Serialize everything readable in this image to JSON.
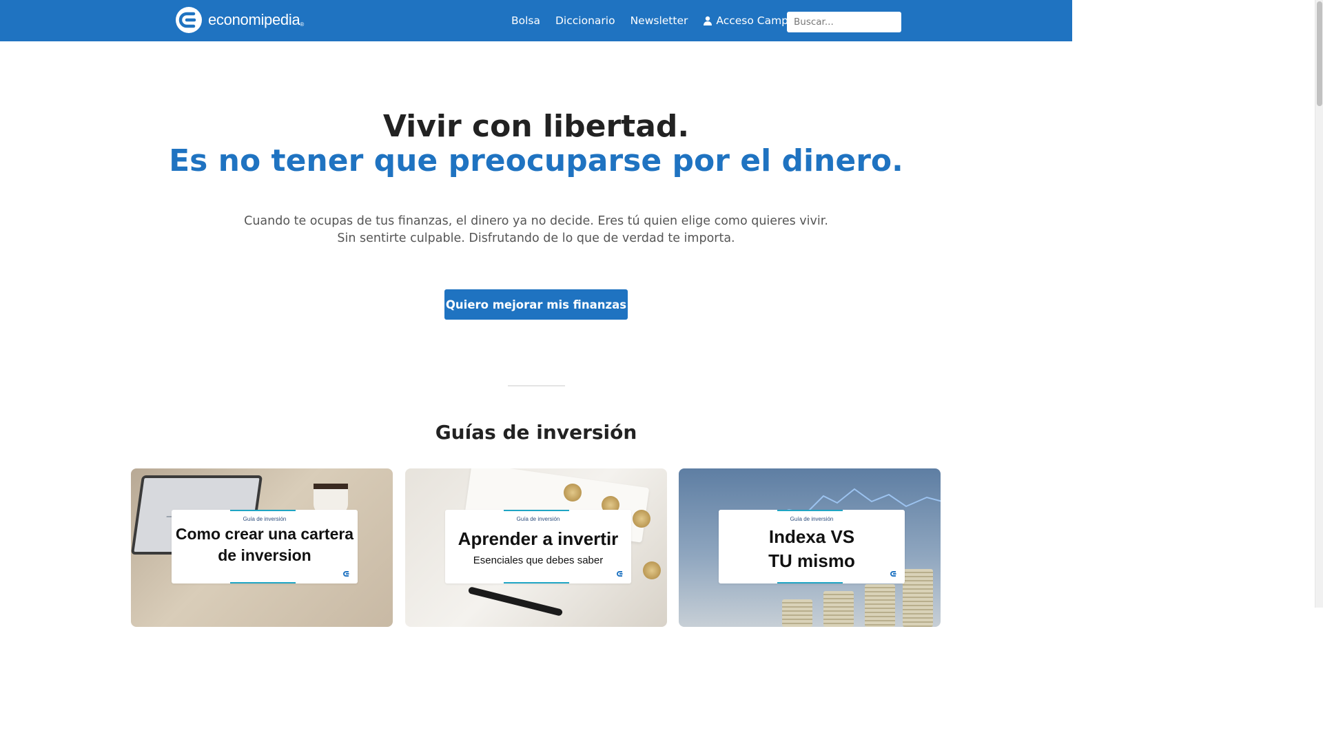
{
  "header": {
    "logo_text": "economipedia",
    "logo_mark": "®",
    "nav": [
      {
        "label": "Bolsa"
      },
      {
        "label": "Diccionario"
      },
      {
        "label": "Newsletter"
      },
      {
        "label": "Acceso Campus",
        "icon": "user-icon"
      }
    ],
    "search": {
      "placeholder": "Buscar...",
      "value": ""
    },
    "background": "#1f73c1"
  },
  "hero": {
    "title": "Vivir con libertad.",
    "subtitle": "Es no tener que preocuparse por el dinero.",
    "text_line1": "Cuando te ocupas de tus finanzas, el dinero ya no decide. Eres tú quien elige como quieres vivir.",
    "text_line2": "Sin sentirte culpable. Disfrutando de lo que de verdad te importa.",
    "cta_label": "Quiero mejorar mis finanzas",
    "accent": "#1f73c1"
  },
  "guides": {
    "title": "Guías de inversión",
    "cards": [
      {
        "tag": "Guía de inversión",
        "heading": "Como crear una cartera\nde inversion"
      },
      {
        "tag": "Guía de inversión",
        "heading": "Aprender a invertir",
        "subheading": "Esenciales que debes saber"
      },
      {
        "tag": "Guía de inversión",
        "heading": "Indexa VS\nTU mismo"
      }
    ]
  }
}
